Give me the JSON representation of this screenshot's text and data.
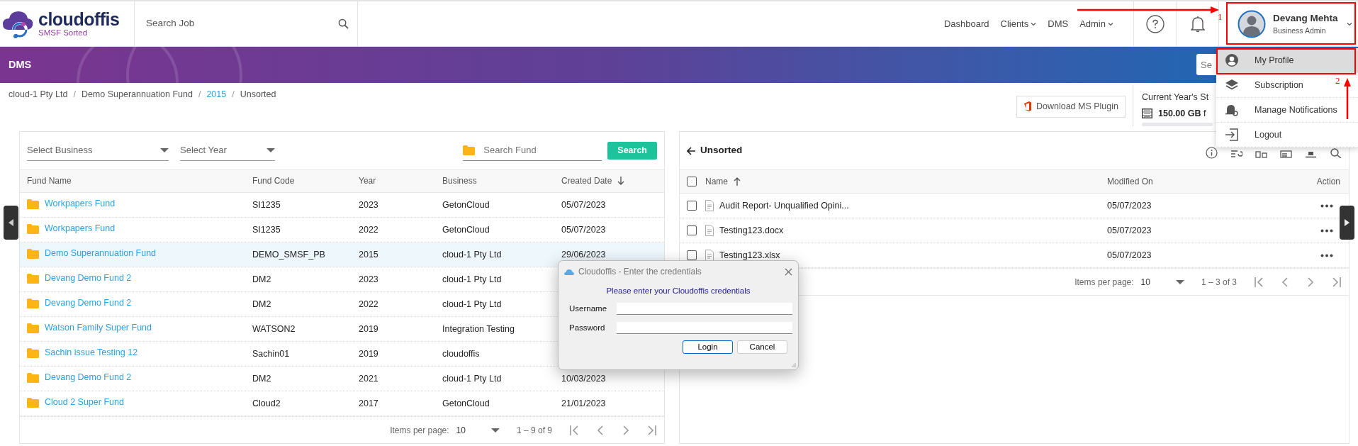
{
  "header": {
    "logo": {
      "name": "cloudoffis",
      "tagline": "SMSF Sorted"
    },
    "search": {
      "placeholder": "Search Job"
    },
    "nav": [
      {
        "label": "Dashboard",
        "has_menu": false
      },
      {
        "label": "Clients",
        "has_menu": true
      },
      {
        "label": "DMS",
        "has_menu": false
      },
      {
        "label": "Admin",
        "has_menu": true
      }
    ],
    "user": {
      "name": "Devang Mehta",
      "role": "Business Admin"
    }
  },
  "banner": {
    "title": "DMS",
    "search": {
      "placeholder": "Se"
    }
  },
  "breadcrumb": [
    {
      "label": "cloud-1 Pty Ltd",
      "link": false
    },
    {
      "separator": "/",
      "label": "Demo Superannuation Fund",
      "link": false
    },
    {
      "separator": "/",
      "label": "2015",
      "link": true
    },
    {
      "separator": "/",
      "label": "Unsorted",
      "link": false
    }
  ],
  "plugin_button": "Download MS Plugin",
  "storage": {
    "title": "Current Year's St",
    "amount": "**150.00 GB** f"
  },
  "user_menu": {
    "expanded": true,
    "items": [
      {
        "label": "My Profile",
        "kind": "profile",
        "selected": true
      },
      {
        "label": "Subscription",
        "kind": "layers",
        "selected": false
      },
      {
        "label": "Manage Notifications",
        "kind": "notifications",
        "selected": false
      },
      {
        "label": "Logout",
        "kind": "logout",
        "selected": false
      }
    ]
  },
  "funds": {
    "business": {
      "placeholder": "Select Business"
    },
    "year": {
      "placeholder": "Select Year"
    },
    "fund_search": {
      "placeholder": "Search Fund"
    },
    "search_button": "Search",
    "columns": [
      {
        "label": "Fund Name"
      },
      {
        "label": "Fund Code"
      },
      {
        "label": "Year"
      },
      {
        "label": "Business"
      },
      {
        "label": "Created Date",
        "sort_descending": true
      }
    ],
    "rows": [
      {
        "fund_name": "Workpapers Fund",
        "fund_code": "SI1235",
        "year": "2023",
        "business": "GetonCloud",
        "created_date": "05/07/2023",
        "selected": false
      },
      {
        "fund_name": "Workpapers Fund",
        "fund_code": "SI1235",
        "year": "2022",
        "business": "GetonCloud",
        "created_date": "05/07/2023",
        "selected": false
      },
      {
        "fund_name": "Demo Superannuation Fund",
        "fund_code": "DEMO_SMSF_PB",
        "year": "2015",
        "business": "cloud-1 Pty Ltd",
        "created_date": "29/06/2023",
        "selected": true
      },
      {
        "fund_name": "Devang Demo Fund 2",
        "fund_code": "DM2",
        "year": "2023",
        "business": "cloud-1 Pty Ltd",
        "selected": false
      },
      {
        "fund_name": "Devang Demo Fund 2",
        "fund_code": "DM2",
        "year": "2022",
        "business": "cloud-1 Pty Ltd",
        "selected": false
      },
      {
        "fund_name": "Watson Family Super Fund",
        "fund_code": "WATSON2",
        "year": "2019",
        "business": "Integration Testing",
        "selected": false
      },
      {
        "fund_name": "Sachin issue Testing 12",
        "fund_code": "Sachin01",
        "year": "2019",
        "business": "cloudoffis",
        "selected": false
      },
      {
        "fund_name": "Devang Demo Fund 2",
        "fund_code": "DM2",
        "year": "2021",
        "business": "cloud-1 Pty Ltd",
        "created_date": "10/03/2023",
        "selected": false
      },
      {
        "fund_name": "Cloud 2 Super Fund",
        "fund_code": "Cloud2",
        "year": "2017",
        "business": "GetonCloud",
        "created_date": "21/01/2023",
        "selected": false
      }
    ],
    "pagination": {
      "label": "Items per page:",
      "size": "10",
      "range": "1 – 9 of 9"
    }
  },
  "files": {
    "title": "Unsorted",
    "all_checked": false,
    "columns": [
      {
        "label": "Name",
        "sort_ascending": true
      },
      {
        "label": "Modified On"
      },
      {
        "label": "Action"
      }
    ],
    "rows": [
      {
        "name": "Audit Report- Unqualified Opini...",
        "modified": "05/07/2023",
        "checked": false
      },
      {
        "name": "Testing123.docx",
        "modified": "05/07/2023",
        "checked": false
      },
      {
        "name": "Testing123.xlsx",
        "modified": "05/07/2023",
        "checked": false
      }
    ],
    "pagination": {
      "label": "Items per page:",
      "size": "10",
      "range": "1 – 3 of 3"
    }
  },
  "dialog": {
    "title": "Cloudoffis - Enter the credentials",
    "message": "Please enter your Cloudoffis credentials",
    "fields": [
      {
        "label": "Username"
      },
      {
        "label": "Password"
      }
    ],
    "buttons": [
      {
        "label": "Login",
        "default": true
      },
      {
        "label": "Cancel",
        "default": false
      }
    ]
  },
  "annotations": [
    {
      "label": "1"
    },
    {
      "label": "2"
    }
  ]
}
